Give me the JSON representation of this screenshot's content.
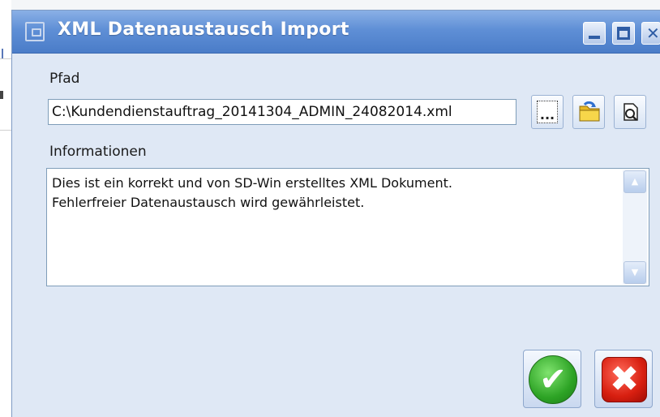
{
  "window": {
    "title": "XML Datenaustausch Import",
    "title_bar_color": "#5f8fd6",
    "body_color": "#dfe8f5",
    "controls": {
      "minimize_icon": "minimize-icon",
      "maximize_icon": "maximize-icon",
      "close_icon": "close-icon"
    }
  },
  "path": {
    "label": "Pfad",
    "value": "C:\\Kundendienstauftrag_20141304_ADMIN_24082014.xml",
    "browse_button_glyph": "...",
    "buttons": [
      "browse-icon",
      "folder-icon",
      "open-document-icon"
    ]
  },
  "info": {
    "label": "Informationen",
    "lines": [
      "Dies ist ein korrekt und von SD-Win erstelltes XML Dokument.",
      "Fehlerfreier Datenaustausch wird gewährleistet."
    ]
  },
  "actions": {
    "ok_icon": "checkmark-icon",
    "ok_color": "#2da325",
    "cancel_icon": "x-icon",
    "cancel_color": "#d81f10"
  }
}
